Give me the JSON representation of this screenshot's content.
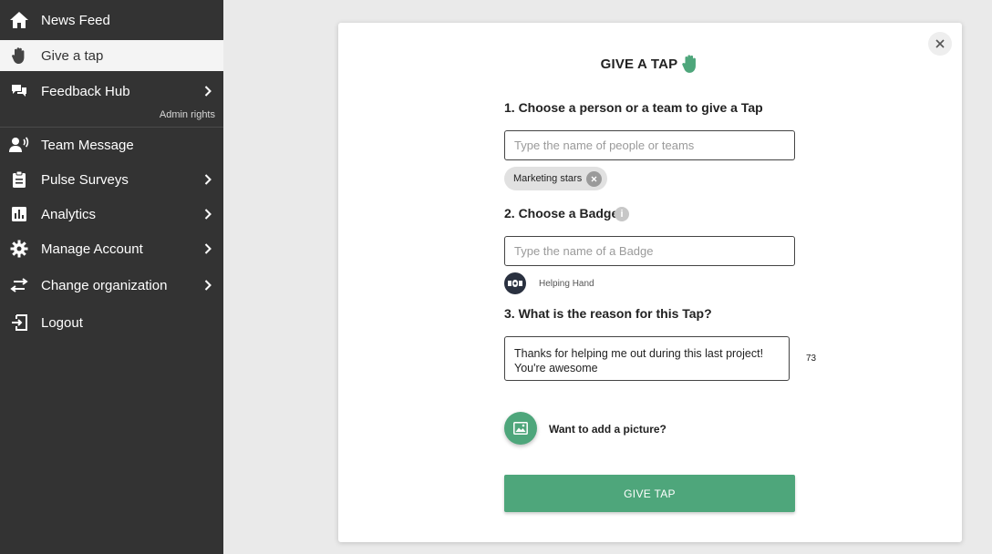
{
  "sidebar": {
    "items": [
      {
        "label": "News Feed",
        "icon": "home-icon"
      },
      {
        "label": "Give a tap",
        "icon": "hand-icon"
      },
      {
        "label": "Feedback Hub",
        "icon": "chat-icon",
        "note": "Admin rights"
      },
      {
        "label": "Team Message",
        "icon": "team-message-icon"
      },
      {
        "label": "Pulse Surveys",
        "icon": "clipboard-icon"
      },
      {
        "label": "Analytics",
        "icon": "analytics-icon"
      },
      {
        "label": "Manage Account",
        "icon": "gear-icon"
      },
      {
        "label": "Change organization",
        "icon": "swap-arrows-icon"
      },
      {
        "label": "Logout",
        "icon": "logout-icon"
      }
    ]
  },
  "modal": {
    "title": "GIVE A TAP",
    "step1": {
      "label": "1. Choose a person or a team to give a Tap",
      "placeholder": "Type the name of people or teams",
      "selected_chip": "Marketing stars"
    },
    "step2": {
      "label": "2. Choose a Badge",
      "info": "i",
      "placeholder": "Type the name of a Badge",
      "selected_badge": "Helping Hand"
    },
    "step3": {
      "label": "3. What is the reason for this Tap?",
      "value": "Thanks for helping me out during this last project! You're awesome",
      "char_count": "73"
    },
    "picture_label": "Want to add a picture?",
    "submit_label": "GIVE TAP"
  },
  "colors": {
    "sidebar_bg": "#333333",
    "accent_green": "#4ea67b",
    "badge_dark": "#2a3140"
  }
}
